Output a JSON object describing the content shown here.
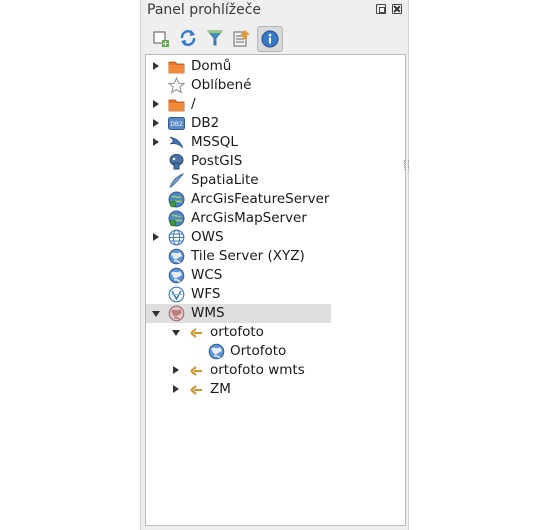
{
  "panel": {
    "title": "Panel prohlížeče",
    "float_button_label": "",
    "close_button_label": ""
  },
  "toolbar": {
    "buttons": [
      {
        "name": "add-selected-layers",
        "icon": "add-layer-icon"
      },
      {
        "name": "refresh",
        "icon": "refresh-icon"
      },
      {
        "name": "filter",
        "icon": "filter-icon"
      },
      {
        "name": "collapse-all",
        "icon": "collapse-icon"
      },
      {
        "name": "properties",
        "icon": "info-icon",
        "active": true
      }
    ]
  },
  "tree": {
    "items": [
      {
        "label": "Domů",
        "icon": "folder-icon",
        "expander": "collapsed"
      },
      {
        "label": "Oblíbené",
        "icon": "star-icon",
        "expander": "none"
      },
      {
        "label": "/",
        "icon": "folder-icon",
        "expander": "collapsed"
      },
      {
        "label": "DB2",
        "icon": "db2-icon",
        "expander": "collapsed"
      },
      {
        "label": "MSSQL",
        "icon": "mssql-icon",
        "expander": "collapsed"
      },
      {
        "label": "PostGIS",
        "icon": "postgis-icon",
        "expander": "none"
      },
      {
        "label": "SpatiaLite",
        "icon": "spatialite-icon",
        "expander": "none"
      },
      {
        "label": "ArcGisFeatureServer",
        "icon": "arcgis-feature-icon",
        "expander": "none"
      },
      {
        "label": "ArcGisMapServer",
        "icon": "arcgis-map-icon",
        "expander": "none"
      },
      {
        "label": "OWS",
        "icon": "ows-globe-icon",
        "expander": "collapsed"
      },
      {
        "label": "Tile Server (XYZ)",
        "icon": "xyz-globe-icon",
        "expander": "none"
      },
      {
        "label": "WCS",
        "icon": "wcs-globe-icon",
        "expander": "none"
      },
      {
        "label": "WFS",
        "icon": "wfs-globe-icon",
        "expander": "none"
      },
      {
        "label": "WMS",
        "icon": "wms-globe-icon",
        "expander": "expanded",
        "selected": true
      },
      {
        "label": "ortofoto",
        "icon": "connection-icon",
        "expander": "expanded"
      },
      {
        "label": "Ortofoto",
        "icon": "raster-layer-icon",
        "expander": "none"
      },
      {
        "label": "ortofoto wmts",
        "icon": "connection-icon",
        "expander": "collapsed"
      },
      {
        "label": "ZM",
        "icon": "connection-icon",
        "expander": "collapsed"
      }
    ]
  },
  "colors": {
    "folder": "#e8732a",
    "globe_blue": "#3f7cc4",
    "selection": "#dedede",
    "connection": "#c98a1a"
  }
}
